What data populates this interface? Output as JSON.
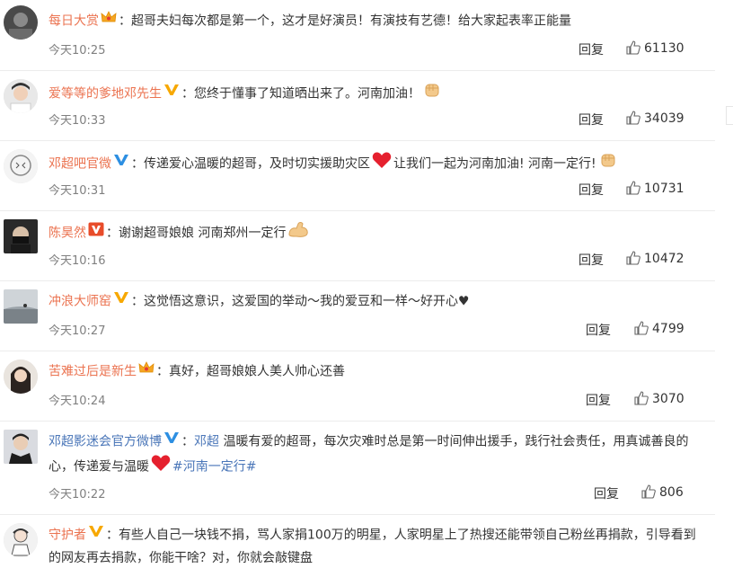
{
  "comments": [
    {
      "name": "每日大赏",
      "badge": "crown",
      "text": "超哥夫妇每次都是第一个，这才是好演员！有演技有艺德！给大家起表率正能量",
      "time": "今天10:25",
      "reply": "回复",
      "likes": "61130"
    },
    {
      "name": "爱等等的爹地邓先生",
      "badge": "v-gold",
      "text": "您终于懂事了知道晒出来了。河南加油！",
      "emoji": "fist-icon",
      "time": "今天10:33",
      "reply": "回复",
      "likes": "34039"
    },
    {
      "name": "邓超吧官微",
      "badge": "v-blue",
      "text_a": "传递爱心温暖的超哥，及时切实援助灾区",
      "text_b": "让我们一起为河南加油! 河南一定行!",
      "emoji_a": "heart-icon",
      "emoji_b": "fist-icon",
      "time": "今天10:31",
      "reply": "回复",
      "likes": "10731"
    },
    {
      "name": "陈昊然",
      "badge": "v-red",
      "text": "谢谢超哥娘娘 河南郑州一定行",
      "emoji": "muscle-icon",
      "time": "今天10:16",
      "reply": "回复",
      "likes": "10472"
    },
    {
      "name": "冲浪大师窑",
      "badge": "v-gold",
      "text": "这觉悟这意识，这爱国的举动～我的爱豆和一样～好开心♥",
      "time": "今天10:27",
      "reply": "回复",
      "likes": "4799"
    },
    {
      "name": "苦难过后是新生",
      "badge": "crown",
      "text": "真好，超哥娘娘人美人帅心还善",
      "time": "今天10:24",
      "reply": "回复",
      "likes": "3070"
    },
    {
      "name": "邓超影迷会官方微博",
      "badge": "v-blue",
      "mention": "邓超",
      "text_a": "温暖有爱的超哥，每次灾难时总是第一时间伸出援手，践行社会责任，用真诚善良的心，传递爱与温暖",
      "emoji_a": "heart-icon",
      "topic": "#河南一定行#",
      "time": "今天10:22",
      "reply": "回复",
      "likes": "806"
    },
    {
      "name": "守护者",
      "badge": "v-gold",
      "text": "有些人自己一块钱不捐，骂人家捐100万的明星，人家明星上了热搜还能带领自己粉丝再捐款，引导看到的网友再去捐款，你能干啥？对，你就会敲键盘"
    }
  ],
  "colon": "：",
  "colors": {
    "username": "#eb7350",
    "link": "#4a76b8",
    "meta": "#808080",
    "text": "#333333"
  }
}
